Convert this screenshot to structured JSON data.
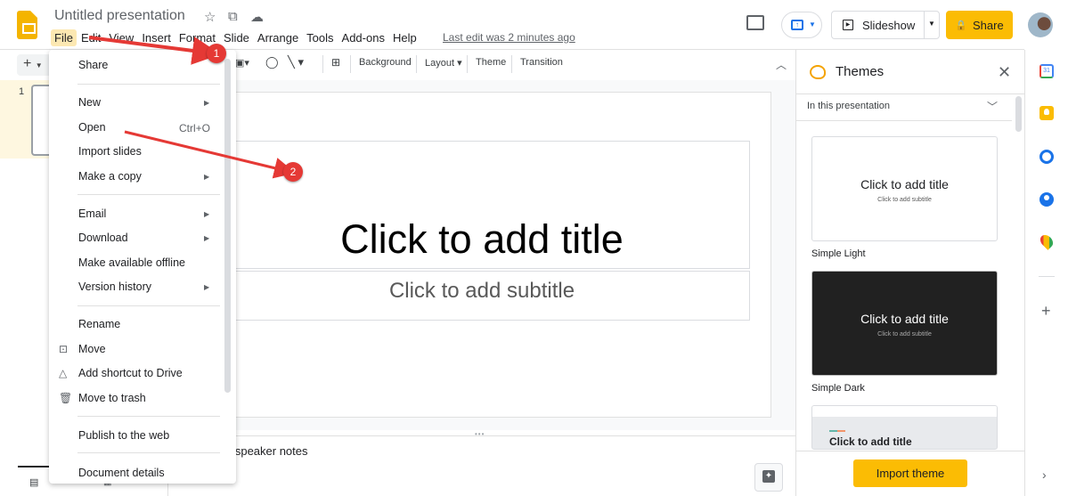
{
  "app": {
    "title": "Untitled presentation",
    "menu": [
      "File",
      "Edit",
      "View",
      "Insert",
      "Format",
      "Slide",
      "Arrange",
      "Tools",
      "Add-ons",
      "Help"
    ],
    "last_edit": "Last edit was 2 minutes ago"
  },
  "header": {
    "slideshow_label": "Slideshow",
    "share_label": "Share"
  },
  "toolbar": {
    "new_slide": "+",
    "background": "Background",
    "layout": "Layout",
    "theme": "Theme",
    "transition": "Transition"
  },
  "filmstrip": {
    "slide_number": "1"
  },
  "slide": {
    "title_placeholder": "Click to add title",
    "subtitle_placeholder": "Click to add subtitle"
  },
  "notes": {
    "placeholder_partial": "d speaker notes"
  },
  "file_menu": {
    "items": [
      {
        "label": "Share"
      },
      {
        "label": "New",
        "submenu": true
      },
      {
        "label": "Open",
        "shortcut": "Ctrl+O"
      },
      {
        "label": "Import slides"
      },
      {
        "label": "Make a copy",
        "submenu": true
      },
      {
        "label": "Email",
        "submenu": true
      },
      {
        "label": "Download",
        "submenu": true
      },
      {
        "label": "Make available offline"
      },
      {
        "label": "Version history",
        "submenu": true
      },
      {
        "label": "Rename"
      },
      {
        "label": "Move",
        "icon": "folder-move-icon"
      },
      {
        "label": "Add shortcut to Drive",
        "icon": "drive-shortcut-icon"
      },
      {
        "label": "Move to trash",
        "icon": "trash-icon"
      },
      {
        "label": "Publish to the web"
      },
      {
        "label": "Document details"
      }
    ]
  },
  "themes_panel": {
    "title": "Themes",
    "filter": "In this presentation",
    "themes": [
      {
        "name": "Simple Light",
        "preview_title": "Click to add title",
        "preview_subtitle": "Click to add subtitle"
      },
      {
        "name": "Simple Dark",
        "preview_title": "Click to add title",
        "preview_subtitle": "Click to add subtitle"
      },
      {
        "name": "",
        "preview_title": "Click to add title"
      }
    ],
    "import_label": "Import theme"
  },
  "annotations": [
    {
      "number": "1",
      "target": "File"
    },
    {
      "number": "2",
      "target": "Open"
    }
  ],
  "colors": {
    "accent_yellow": "#fbbc04",
    "annotation_red": "#e53935",
    "active_menu_bg": "#fce8b2"
  }
}
